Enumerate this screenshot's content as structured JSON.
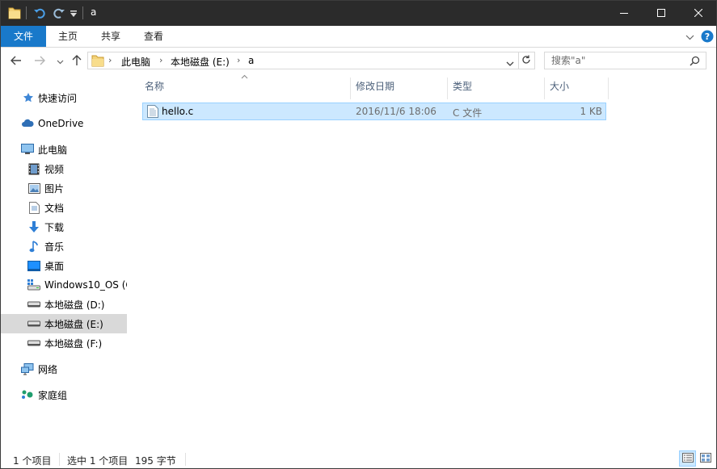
{
  "titlebar": {
    "title": "a",
    "icons": [
      "folder-icon",
      "undo-icon",
      "redo-icon",
      "customize-qat-icon"
    ],
    "controls": [
      "minimize-icon",
      "maximize-icon",
      "close-icon"
    ]
  },
  "ribbon": {
    "tabs": [
      "文件",
      "主页",
      "共享",
      "查看"
    ],
    "accent": "#1979ca"
  },
  "address": {
    "crumbs": [
      "此电脑",
      "本地磁盘 (E:)",
      "a"
    ],
    "search_placeholder": "搜索\"a\""
  },
  "nav": {
    "items": [
      {
        "label": "快速访问",
        "icon": "pin-star-icon"
      },
      {
        "label": "OneDrive",
        "icon": "cloud-icon"
      },
      {
        "label": "此电脑",
        "icon": "computer-icon"
      },
      {
        "label": "视频",
        "icon": "video-icon"
      },
      {
        "label": "图片",
        "icon": "pictures-icon"
      },
      {
        "label": "文档",
        "icon": "documents-icon"
      },
      {
        "label": "下载",
        "icon": "download-icon"
      },
      {
        "label": "音乐",
        "icon": "music-icon"
      },
      {
        "label": "桌面",
        "icon": "desktop-icon"
      },
      {
        "label": "Windows10_OS (C",
        "icon": "os-drive-icon"
      },
      {
        "label": "本地磁盘 (D:)",
        "icon": "drive-icon"
      },
      {
        "label": "本地磁盘 (E:)",
        "icon": "drive-icon"
      },
      {
        "label": "本地磁盘 (F:)",
        "icon": "drive-icon"
      },
      {
        "label": "网络",
        "icon": "network-icon"
      },
      {
        "label": "家庭组",
        "icon": "homegroup-icon"
      }
    ],
    "selected": "本地磁盘 (E:)"
  },
  "columns": [
    "名称",
    "修改日期",
    "类型",
    "大小"
  ],
  "files": [
    {
      "name": "hello.c",
      "modified": "2016/11/6 18:06",
      "type": "C 文件",
      "size": "1 KB",
      "icon": "c-source-file-icon"
    }
  ],
  "status": {
    "item_count": "1 个项目",
    "selected": "选中 1 个项目",
    "size": "195 字节"
  }
}
